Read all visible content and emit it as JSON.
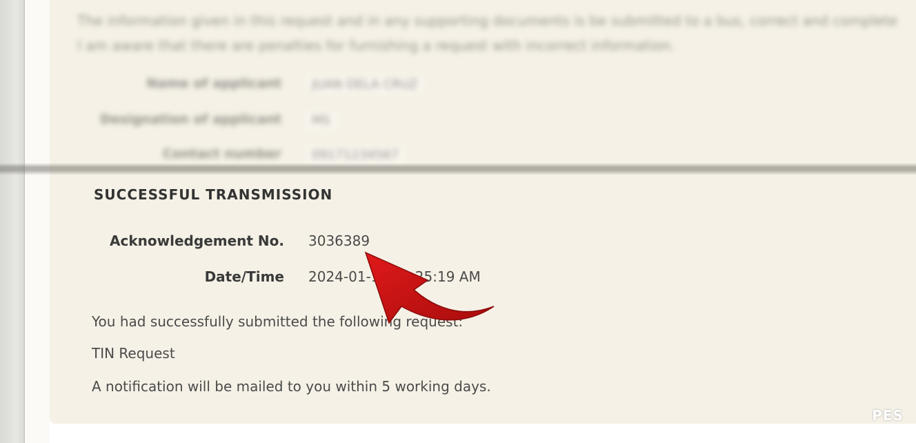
{
  "blurred_background": {
    "intro_line_1": "The information given in this request and in any supporting documents is be submitted to a bus, correct and complete",
    "intro_line_2": "I am aware that there are penalties for furnishing a request with incorrect information.",
    "rows": [
      {
        "label": "Name of applicant",
        "value": "JUAN DELA CRUZ"
      },
      {
        "label": "Designation of applicant",
        "value": "MS"
      },
      {
        "label": "Contact number",
        "value": "09171234567"
      }
    ]
  },
  "confirmation": {
    "title": "SUCCESSFUL TRANSMISSION",
    "ack_label": "Acknowledgement No.",
    "ack_value": "3036389",
    "datetime_label": "Date/Time",
    "datetime_value": "2024-01-18 10:25:19 AM",
    "submitted_text": "You had successfully submitted the following request:",
    "request_type": "TIN Request",
    "notification_text": "A notification will be mailed to you within 5 working days."
  },
  "overlay": {
    "arrow_color": "#cc1111",
    "arrow_icon": "curved-arrow-icon",
    "watermark_text": "PES"
  }
}
